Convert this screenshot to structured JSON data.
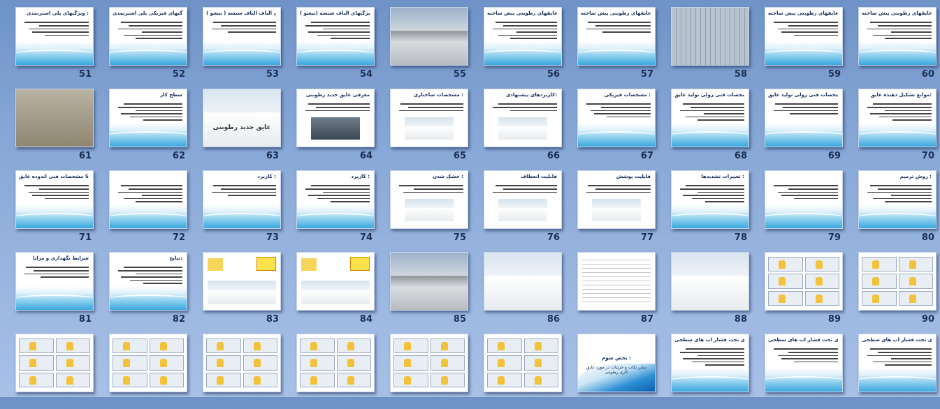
{
  "slides": [
    {
      "num": "60",
      "kind": "text",
      "title": "معایب عایقهای رطوبتی پیش ساخته:"
    },
    {
      "num": "59",
      "kind": "text",
      "title": "مزایای عایقهای رطوبتی پیش ساخته"
    },
    {
      "num": "58",
      "kind": "photo",
      "photo": "wall"
    },
    {
      "num": "57",
      "kind": "text",
      "title": "مشخصات عایقهای رطوبتی پیش ساخته"
    },
    {
      "num": "56",
      "kind": "text",
      "title": "مشخصات عایقهای رطوبتی پیش ساخته"
    },
    {
      "num": "55",
      "kind": "photo",
      "photo": "roof"
    },
    {
      "num": "54",
      "kind": "text",
      "title": "ویژگیهای الیاف شیشه (تیشو ):"
    },
    {
      "num": "53",
      "kind": "text",
      "title": "ویژگیهای الیاف الیاف شیشه ( تیشو ):"
    },
    {
      "num": "52",
      "kind": "text",
      "title": "ویژگیهای فیزیکی پلی استرنمدی :"
    },
    {
      "num": "51",
      "kind": "text",
      "title": "ویژگیهای پلی استرنمدی :"
    },
    {
      "num": "70",
      "kind": "text",
      "title": "موانع تشکیل دهنده عایق:"
    },
    {
      "num": "69",
      "kind": "text",
      "title": "مشخصات فنی رولی تولید عایق :"
    },
    {
      "num": "68",
      "kind": "text",
      "title": "مشخصات فنی رولی تولید عایق :"
    },
    {
      "num": "67",
      "kind": "text",
      "title": "مشخصات فیزیکی :"
    },
    {
      "num": "66",
      "kind": "textphoto",
      "title": "کاربردهای پیشنهادی:",
      "photo": "white"
    },
    {
      "num": "65",
      "kind": "textphoto",
      "title": "مشخصات ساختاری :",
      "photo": "white"
    },
    {
      "num": "64",
      "kind": "textphoto",
      "title": "معرفی عایق جدید رطوبتی",
      "photo": "dark"
    },
    {
      "num": "63",
      "kind": "caption",
      "caption": "عایق جدید رطوبتی",
      "photo": "white"
    },
    {
      "num": "62",
      "kind": "text",
      "title": "سطح کار"
    },
    {
      "num": "61",
      "kind": "photo",
      "photo": "sand"
    },
    {
      "num": "80",
      "kind": "text",
      "title": "روش ترمیم :"
    },
    {
      "num": "79",
      "kind": "text",
      "title": ""
    },
    {
      "num": "78",
      "kind": "text",
      "title": "تغییرات تشدیدها :"
    },
    {
      "num": "77",
      "kind": "textphoto",
      "title": "قابلیت پوشش",
      "photo": "white"
    },
    {
      "num": "76",
      "kind": "textphoto",
      "title": "قابلیت انعطاف",
      "photo": "white"
    },
    {
      "num": "75",
      "kind": "textphoto",
      "title": "خشک شدن :",
      "photo": "white"
    },
    {
      "num": "74",
      "kind": "text",
      "title": "کاربرد :"
    },
    {
      "num": "73",
      "kind": "text",
      "title": "کاربرد :"
    },
    {
      "num": "72",
      "kind": "text",
      "title": ""
    },
    {
      "num": "71",
      "kind": "text",
      "title": "مشخصات فنی اندوده عایق SH 765N"
    },
    {
      "num": "90",
      "kind": "figs"
    },
    {
      "num": "89",
      "kind": "figs"
    },
    {
      "num": "88",
      "kind": "photo",
      "photo": "white"
    },
    {
      "num": "87",
      "kind": "table"
    },
    {
      "num": "86",
      "kind": "photo",
      "photo": "white"
    },
    {
      "num": "85",
      "kind": "photo",
      "photo": "roof"
    },
    {
      "num": "84",
      "kind": "ad"
    },
    {
      "num": "83",
      "kind": "ad"
    },
    {
      "num": "82",
      "kind": "text",
      "title": "نتایج:"
    },
    {
      "num": "81",
      "kind": "text",
      "title": "شرایط نگهداری و مزایا"
    },
    {
      "num": "",
      "kind": "text",
      "title": "عایقکاری رطوبتی زمانهای تحت فشار آب های سطحی :"
    },
    {
      "num": "",
      "kind": "text",
      "title": "عایقکاری رطوبتی زمانهای تحت فشار آب های سطحی :"
    },
    {
      "num": "",
      "kind": "text",
      "title": "عایقکاری رطوبتی زمانهای تحت فشار آب های سطحی :"
    },
    {
      "num": "",
      "kind": "section",
      "title": "بخش سوم :",
      "subtitle": "سایر نکات و جزئیات در مورد عایق کاری رطوبتی"
    },
    {
      "num": "",
      "kind": "figs"
    },
    {
      "num": "",
      "kind": "figs"
    },
    {
      "num": "",
      "kind": "figs"
    },
    {
      "num": "",
      "kind": "figs"
    },
    {
      "num": "",
      "kind": "figs"
    },
    {
      "num": "",
      "kind": "figs"
    }
  ]
}
